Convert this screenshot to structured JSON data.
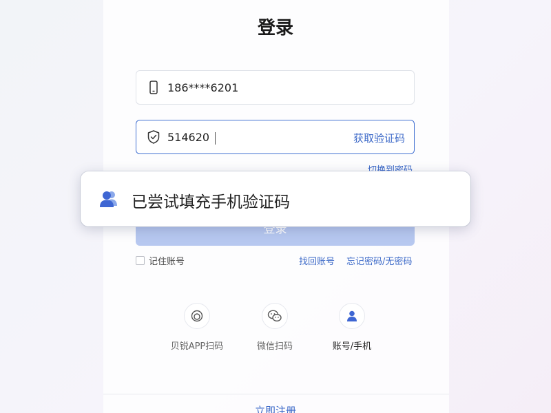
{
  "title": "登录",
  "phone_field": {
    "value": "186****6201",
    "icon": "phone-icon"
  },
  "code_field": {
    "value": "514620",
    "get_code_label": "获取验证码",
    "icon": "shield-check-icon"
  },
  "switch_to_password": "切换到密码",
  "login_button": "登录",
  "toast": {
    "message": "已尝试填充手机验证码",
    "icon": "users-icon"
  },
  "remember_account": "记住账号",
  "find_account": "找回账号",
  "forgot_password": "忘记密码/无密码",
  "login_methods": [
    {
      "label": "贝锐APP扫码",
      "icon": "app-scan-icon"
    },
    {
      "label": "微信扫码",
      "icon": "wechat-icon"
    },
    {
      "label": "账号/手机",
      "icon": "user-icon"
    }
  ],
  "register": "立即注册",
  "colors": {
    "accent": "#3c69c8",
    "button_disabled": "#b7c8f0",
    "active_border": "#3f6fd1"
  }
}
